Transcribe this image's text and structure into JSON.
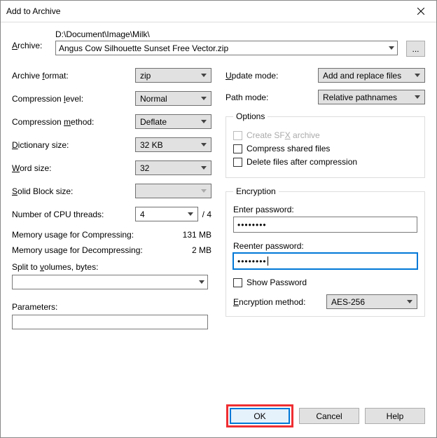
{
  "window": {
    "title": "Add to Archive"
  },
  "archive": {
    "label": "Archive:",
    "path": "D:\\Document\\Image\\Milk\\",
    "filename": "Angus Cow Silhouette Sunset Free Vector.zip",
    "browse": "..."
  },
  "left": {
    "format": {
      "label": "Archive format:",
      "value": "zip"
    },
    "level": {
      "label": "Compression level:",
      "value": "Normal"
    },
    "method": {
      "label": "Compression method:",
      "value": "Deflate"
    },
    "dict": {
      "label": "Dictionary size:",
      "value": "32 KB"
    },
    "word": {
      "label": "Word size:",
      "value": "32"
    },
    "block": {
      "label": "Solid Block size:",
      "value": ""
    },
    "cpu": {
      "label": "Number of CPU threads:",
      "value": "4",
      "total": "/ 4"
    },
    "mem_comp": {
      "label": "Memory usage for Compressing:",
      "value": "131 MB"
    },
    "mem_decomp": {
      "label": "Memory usage for Decompressing:",
      "value": "2 MB"
    },
    "split": {
      "label": "Split to volumes, bytes:",
      "value": ""
    },
    "params": {
      "label": "Parameters:",
      "value": ""
    }
  },
  "right": {
    "update": {
      "label": "Update mode:",
      "value": "Add and replace files"
    },
    "pathmode": {
      "label": "Path mode:",
      "value": "Relative pathnames"
    },
    "options": {
      "legend": "Options",
      "sfx": "Create SFX archive",
      "shared": "Compress shared files",
      "delete": "Delete files after compression"
    },
    "encryption": {
      "legend": "Encryption",
      "enter": "Enter password:",
      "reenter": "Reenter password:",
      "pw1": "••••••••",
      "pw2": "••••••••",
      "show": "Show Password",
      "method_label": "Encryption method:",
      "method_value": "AES-256"
    }
  },
  "buttons": {
    "ok": "OK",
    "cancel": "Cancel",
    "help": "Help"
  }
}
